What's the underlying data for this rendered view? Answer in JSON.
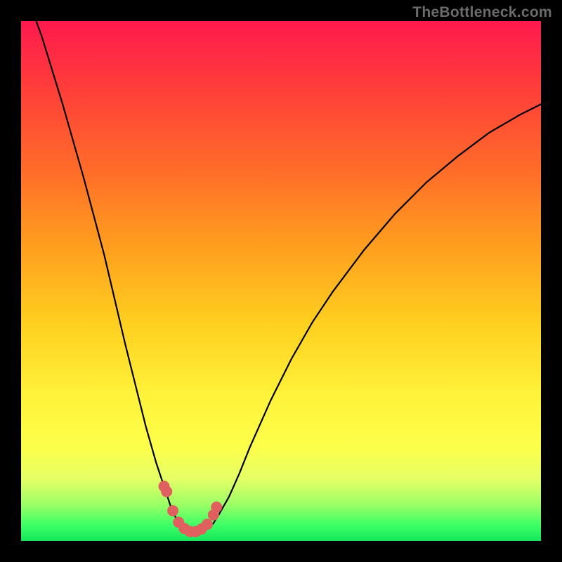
{
  "watermark": "TheBottleneck.com",
  "chart_data": {
    "type": "line",
    "title": "",
    "xlabel": "",
    "ylabel": "",
    "xlim": [
      0,
      100
    ],
    "ylim": [
      0,
      100
    ],
    "x": [
      0,
      4,
      8,
      12,
      16,
      20,
      22,
      24,
      26,
      28,
      29,
      30,
      31,
      32,
      33,
      34,
      35,
      36,
      37,
      38,
      40,
      42,
      44,
      48,
      52,
      56,
      60,
      66,
      72,
      78,
      84,
      90,
      96,
      100
    ],
    "y": [
      108,
      97,
      84,
      70,
      55,
      38,
      30,
      22,
      15,
      9,
      6,
      4,
      2.5,
      1.8,
      1.6,
      1.6,
      1.8,
      2.4,
      3.4,
      5,
      8.5,
      13,
      18,
      27,
      35,
      42,
      48,
      56,
      63,
      69,
      74,
      78.5,
      82,
      84
    ],
    "markers": {
      "x": [
        27.5,
        28.0,
        29.2,
        30.3,
        31.4,
        32.5,
        33.6,
        34.7,
        35.8,
        37.0,
        37.6
      ],
      "y": [
        10.5,
        9.5,
        5.8,
        3.6,
        2.4,
        1.8,
        1.8,
        2.3,
        3.2,
        5.0,
        6.5
      ]
    },
    "background_gradient": {
      "top": "#ff1a4d",
      "mid": "#fff23a",
      "bottom": "#14e65a"
    }
  }
}
